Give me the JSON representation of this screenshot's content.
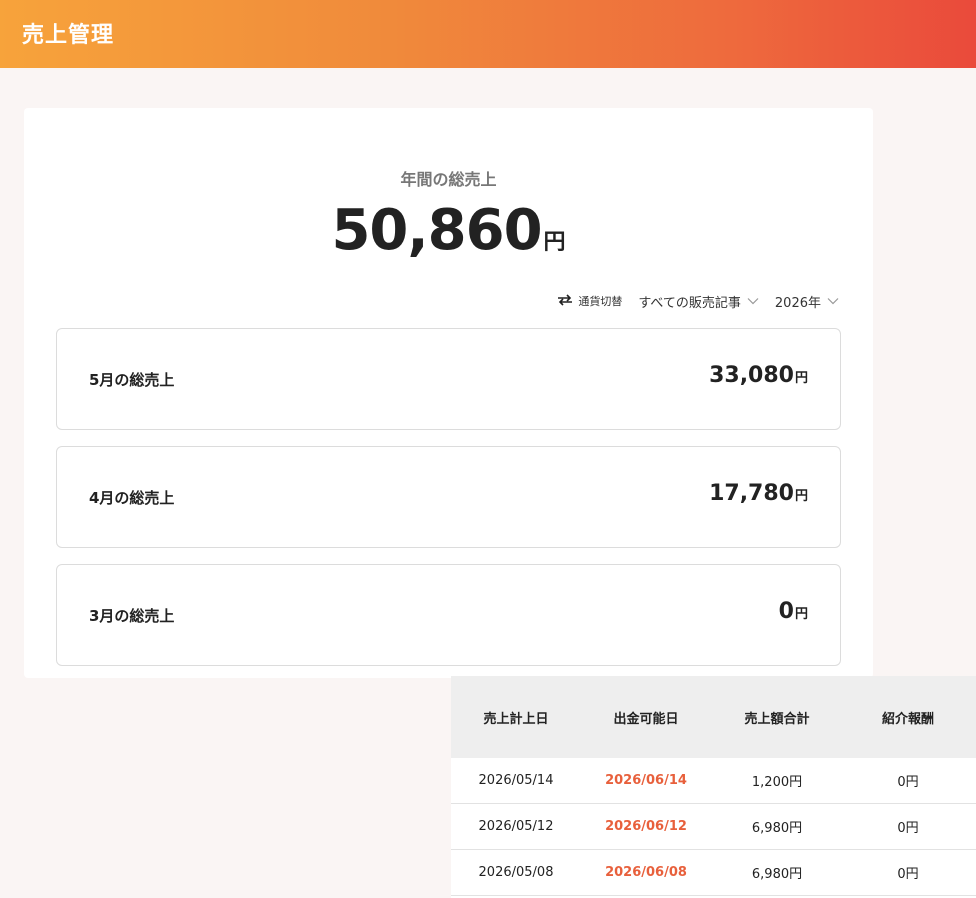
{
  "header": {
    "title": "売上管理"
  },
  "summary": {
    "label": "年間の総売上",
    "value": "50,860",
    "unit": "円"
  },
  "filters": {
    "currency_label": "通貨切替",
    "articles_label": "すべての販売記事",
    "year_label": "2026年"
  },
  "months": [
    {
      "label": "5月の総売上",
      "value": "33,080",
      "unit": "円"
    },
    {
      "label": "4月の総売上",
      "value": "17,780",
      "unit": "円"
    },
    {
      "label": "3月の総売上",
      "value": "0",
      "unit": "円"
    }
  ],
  "table": {
    "headers": [
      "売上計上日",
      "出金可能日",
      "売上額合計",
      "紹介報酬"
    ],
    "rows": [
      {
        "sale_date": "2026/05/14",
        "payout_date": "2026/06/14",
        "total": "1,200円",
        "referral": "0円"
      },
      {
        "sale_date": "2026/05/12",
        "payout_date": "2026/06/12",
        "total": "6,980円",
        "referral": "0円"
      },
      {
        "sale_date": "2026/05/08",
        "payout_date": "2026/06/08",
        "total": "6,980円",
        "referral": "0円"
      }
    ]
  },
  "colors": {
    "header_gradient_start": "#f7a33b",
    "header_gradient_end": "#ea4a3b",
    "payout_date": "#e8603c"
  }
}
